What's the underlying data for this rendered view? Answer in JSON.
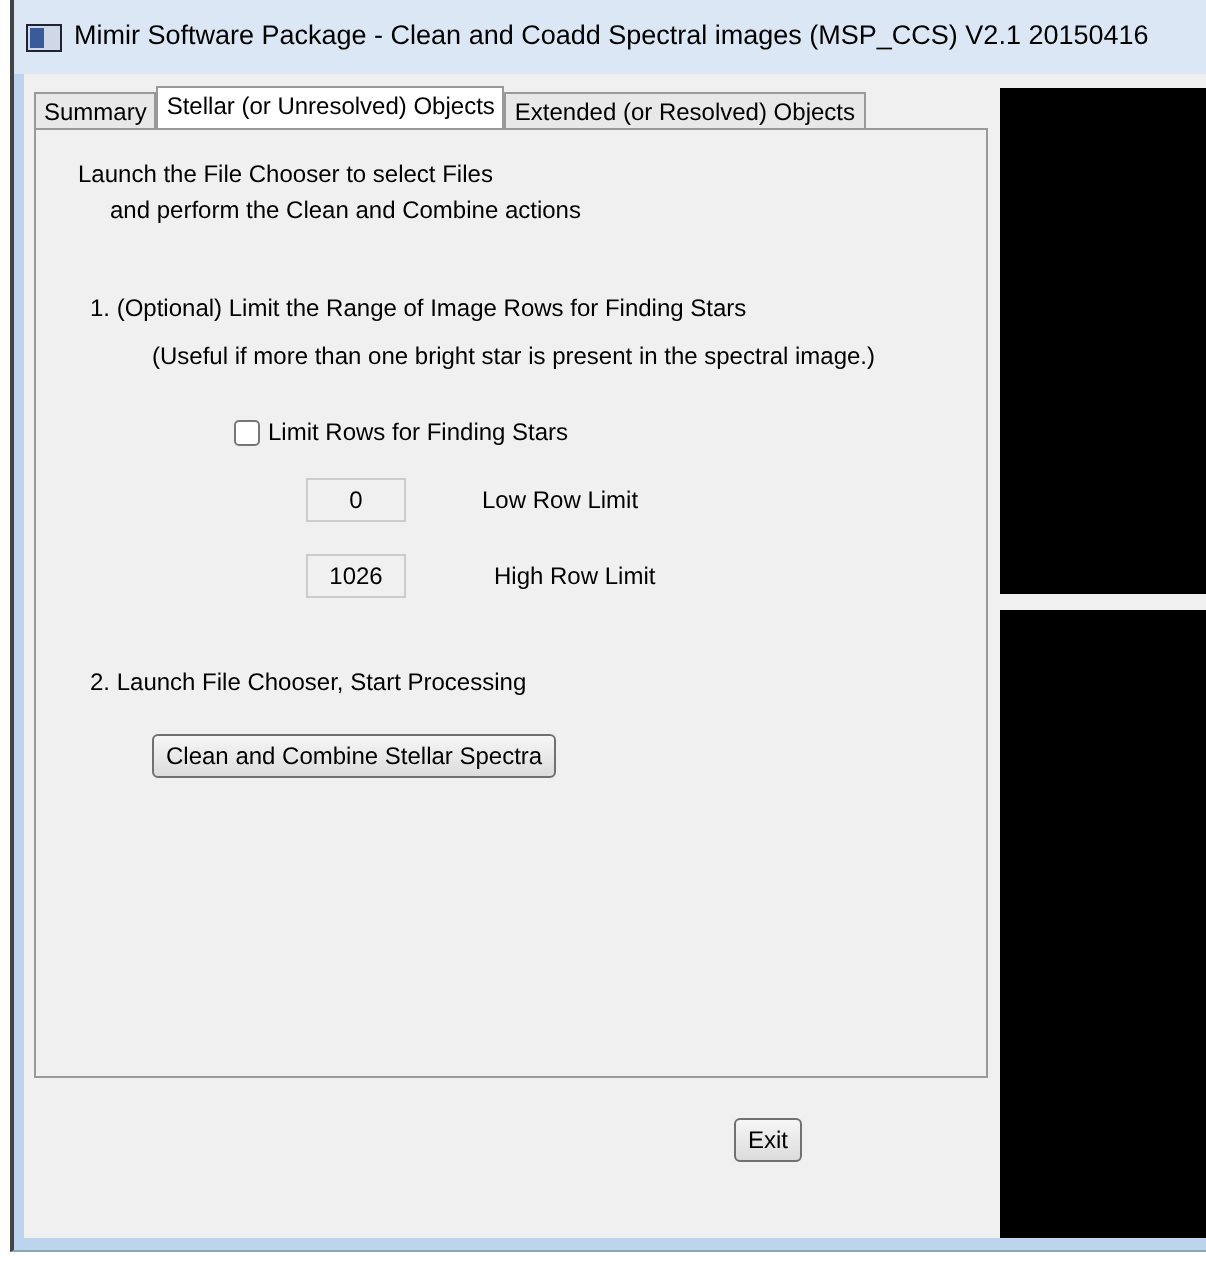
{
  "window": {
    "title": "Mimir Software Package - Clean and Coadd Spectral images (MSP_CCS) V2.1 20150416"
  },
  "tabs": [
    {
      "label": "Summary",
      "selected": false
    },
    {
      "label": "Stellar (or Unresolved) Objects",
      "selected": true
    },
    {
      "label": "Extended (or Resolved) Objects",
      "selected": false
    }
  ],
  "intro": [
    "Launch the File Chooser to select Files",
    "and perform the Clean and Combine actions"
  ],
  "step1": {
    "heading": "1. (Optional) Limit the Range of Image Rows for Finding Stars",
    "note": "(Useful if more than one bright star is present in the spectral image.)"
  },
  "limit_checkbox": {
    "label": "Limit Rows for Finding Stars",
    "checked": false
  },
  "fields": [
    {
      "value": "0",
      "label": "Low Row Limit"
    },
    {
      "value": "1026",
      "label": "High Row Limit"
    }
  ],
  "step2": {
    "heading": "2. Launch File Chooser, Start Processing"
  },
  "process_button": "Clean and Combine Stellar Spectra",
  "exit_button": "Exit"
}
